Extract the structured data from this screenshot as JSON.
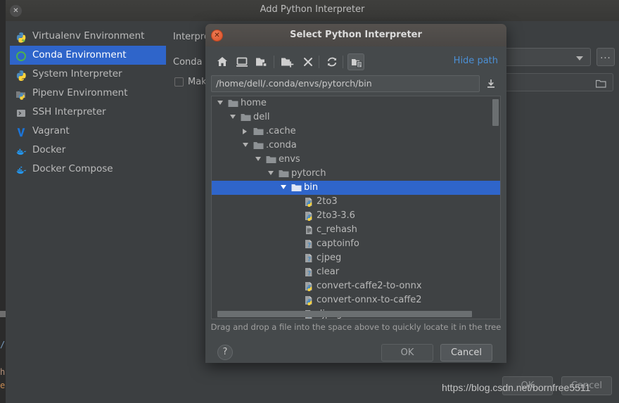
{
  "ide_background": {
    "code_a": "/",
    "code_b": "hu",
    "code_c": "e,"
  },
  "outer_window": {
    "title": "Add Python Interpreter",
    "close_icon": "close-icon",
    "categories": [
      {
        "label": "Virtualenv Environment",
        "icon": "python-virtualenv-icon",
        "selected": false
      },
      {
        "label": "Conda Environment",
        "icon": "conda-ring-icon",
        "selected": true
      },
      {
        "label": "System Interpreter",
        "icon": "python-icon",
        "selected": false
      },
      {
        "label": "Pipenv Environment",
        "icon": "pipenv-folder-icon",
        "selected": false
      },
      {
        "label": "SSH Interpreter",
        "icon": "terminal-icon",
        "selected": false
      },
      {
        "label": "Vagrant",
        "icon": "vagrant-v-icon",
        "selected": false
      },
      {
        "label": "Docker",
        "icon": "docker-whale-icon",
        "selected": false
      },
      {
        "label": "Docker Compose",
        "icon": "docker-compose-icon",
        "selected": false
      }
    ],
    "form": {
      "interpreter_label": "Interpre",
      "conda_exec_label": "Conda e",
      "make_available_label": "Mak",
      "interpreter_value": "",
      "conda_exec_value": "",
      "ellipsis_label": "...",
      "dropdown_icon": "chevron-down-icon",
      "browse_icon": "folder-browse-icon"
    },
    "ok_label": "OK",
    "cancel_label": "Cancel"
  },
  "modal": {
    "title": "Select Python Interpreter",
    "close_icon": "close-icon",
    "toolbar": [
      {
        "name": "home-icon",
        "active": false
      },
      {
        "name": "desktop-icon",
        "active": false
      },
      {
        "name": "project-folder-icon",
        "active": false
      },
      {
        "name": "new-folder-icon",
        "active": false
      },
      {
        "name": "delete-icon",
        "active": false
      },
      {
        "name": "refresh-icon",
        "active": false
      },
      {
        "name": "show-hidden-files-icon",
        "active": true
      }
    ],
    "hide_path_label": "Hide path",
    "path_value": "/home/dell/.conda/envs/pytorch/bin",
    "path_placeholder": "",
    "download_icon": "download-icon",
    "tree": [
      {
        "label": "home",
        "depth": 0,
        "type": "folder-root",
        "state": "open",
        "selected": false
      },
      {
        "label": "dell",
        "depth": 1,
        "type": "folder",
        "state": "open",
        "selected": false
      },
      {
        "label": ".cache",
        "depth": 2,
        "type": "folder",
        "state": "closed",
        "selected": false
      },
      {
        "label": ".conda",
        "depth": 2,
        "type": "folder",
        "state": "open",
        "selected": false
      },
      {
        "label": "envs",
        "depth": 3,
        "type": "folder",
        "state": "open",
        "selected": false
      },
      {
        "label": "pytorch",
        "depth": 4,
        "type": "folder",
        "state": "open",
        "selected": false
      },
      {
        "label": "bin",
        "depth": 5,
        "type": "folder",
        "state": "open",
        "selected": true
      },
      {
        "label": "2to3",
        "depth": 6,
        "type": "python-file",
        "state": "leaf",
        "selected": false
      },
      {
        "label": "2to3-3.6",
        "depth": 6,
        "type": "python-file",
        "state": "leaf",
        "selected": false
      },
      {
        "label": "c_rehash",
        "depth": 6,
        "type": "text-file",
        "state": "leaf",
        "selected": false
      },
      {
        "label": "captoinfo",
        "depth": 6,
        "type": "unknown-file",
        "state": "leaf",
        "selected": false
      },
      {
        "label": "cjpeg",
        "depth": 6,
        "type": "unknown-file",
        "state": "leaf",
        "selected": false
      },
      {
        "label": "clear",
        "depth": 6,
        "type": "unknown-file",
        "state": "leaf",
        "selected": false
      },
      {
        "label": "convert-caffe2-to-onnx",
        "depth": 6,
        "type": "python-file",
        "state": "leaf",
        "selected": false
      },
      {
        "label": "convert-onnx-to-caffe2",
        "depth": 6,
        "type": "python-file",
        "state": "leaf",
        "selected": false
      },
      {
        "label": "djpeg",
        "depth": 6,
        "type": "unknown-file",
        "state": "leaf",
        "selected": false
      }
    ],
    "hint": "Drag and drop a file into the space above to quickly locate it in the tree",
    "help_label": "?",
    "ok_label": "OK",
    "cancel_label": "Cancel"
  },
  "watermark": "https://blog.csdn.net/bornfree5511",
  "colors": {
    "selection_blue": "#2f65ca",
    "link_blue": "#4b8fd4",
    "window_bg": "#3c3f41",
    "modal_bg": "#45494b",
    "tree_bg": "#3f4244",
    "close_orange": "#d9512a"
  }
}
